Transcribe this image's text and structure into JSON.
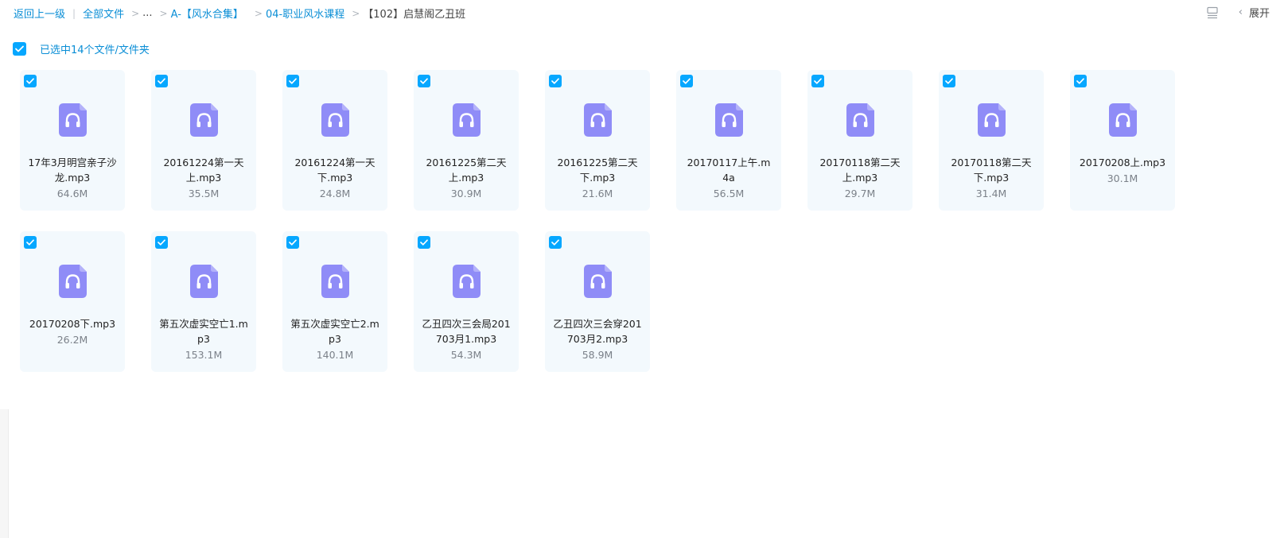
{
  "breadcrumb": {
    "back": "返回上一级",
    "all_files": "全部文件",
    "ellipsis": "...",
    "level1": "A-【风水合集】",
    "level2": "04-职业风水课程",
    "current": "【102】启慧阁乙丑班"
  },
  "toolbar": {
    "expand_label": "展开",
    "layout_icon": "layout-list-icon",
    "collapse_icon": "chevron-left-icon"
  },
  "selection": {
    "text": "已选中14个文件/文件夹"
  },
  "colors": {
    "accent": "#06a7ff",
    "link": "#0a8ed6",
    "card_bg": "#f3f9fd",
    "audio_icon": "#8f8cf7"
  },
  "files": [
    {
      "name": "17年3月明宫亲子沙龙.mp3",
      "size": "64.6M"
    },
    {
      "name": "20161224第一天上.mp3",
      "size": "35.5M"
    },
    {
      "name": "20161224第一天下.mp3",
      "size": "24.8M"
    },
    {
      "name": "20161225第二天上.mp3",
      "size": "30.9M"
    },
    {
      "name": "20161225第二天下.mp3",
      "size": "21.6M"
    },
    {
      "name": "20170117上午.m4a",
      "size": "56.5M"
    },
    {
      "name": "20170118第二天上.mp3",
      "size": "29.7M"
    },
    {
      "name": "20170118第二天下.mp3",
      "size": "31.4M"
    },
    {
      "name": "20170208上.mp3",
      "size": "30.1M"
    },
    {
      "name": "20170208下.mp3",
      "size": "26.2M"
    },
    {
      "name": "第五次虚实空亡1.mp3",
      "size": "153.1M"
    },
    {
      "name": "第五次虚实空亡2.mp3",
      "size": "140.1M"
    },
    {
      "name": "乙丑四次三会局201703月1.mp3",
      "size": "54.3M"
    },
    {
      "name": "乙丑四次三会穿201703月2.mp3",
      "size": "58.9M"
    }
  ]
}
